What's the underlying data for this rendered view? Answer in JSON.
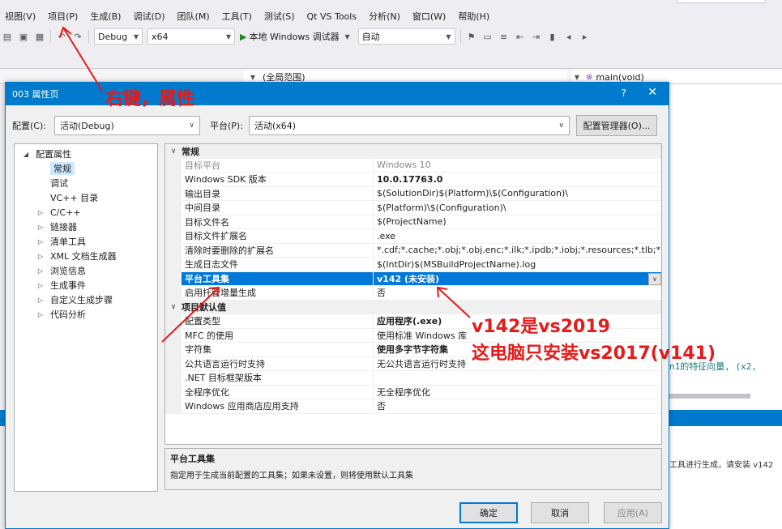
{
  "menu": [
    "视图(V)",
    "项目(P)",
    "生成(B)",
    "调试(D)",
    "团队(M)",
    "工具(T)",
    "测试(S)",
    "Qt VS Tools",
    "分析(N)",
    "窗口(W)",
    "帮助(H)"
  ],
  "toolbar": {
    "config": "Debug",
    "platform": "x64",
    "debugger": "本地 Windows 调试器",
    "mode": "自动"
  },
  "navbar": {
    "scope": "(全局范围)",
    "function": "main(void)"
  },
  "dialog": {
    "title": "003 属性页",
    "help": "?",
    "close": "✕",
    "config_label": "配置(C):",
    "config_value": "活动(Debug)",
    "platform_label": "平台(P):",
    "platform_value": "活动(x64)",
    "config_manager": "配置管理器(O)...",
    "tree": [
      {
        "label": "配置属性",
        "expander": "◢",
        "indent": 0
      },
      {
        "label": "常规",
        "expander": "",
        "indent": 1,
        "selected": true
      },
      {
        "label": "调试",
        "expander": "",
        "indent": 1
      },
      {
        "label": "VC++ 目录",
        "expander": "",
        "indent": 1
      },
      {
        "label": "C/C++",
        "expander": "▷",
        "indent": 1
      },
      {
        "label": "链接器",
        "expander": "▷",
        "indent": 1
      },
      {
        "label": "清单工具",
        "expander": "▷",
        "indent": 1
      },
      {
        "label": "XML 文档生成器",
        "expander": "▷",
        "indent": 1
      },
      {
        "label": "浏览信息",
        "expander": "▷",
        "indent": 1
      },
      {
        "label": "生成事件",
        "expander": "▷",
        "indent": 1
      },
      {
        "label": "自定义生成步骤",
        "expander": "▷",
        "indent": 1
      },
      {
        "label": "代码分析",
        "expander": "▷",
        "indent": 1
      }
    ],
    "grid": [
      {
        "type": "cat",
        "name": "常规"
      },
      {
        "name": "目标平台",
        "value": "Windows 10",
        "disabled": true
      },
      {
        "name": "Windows SDK 版本",
        "value": "10.0.17763.0",
        "bold": true
      },
      {
        "name": "输出目录",
        "value": "$(SolutionDir)$(Platform)\\$(Configuration)\\"
      },
      {
        "name": "中间目录",
        "value": "$(Platform)\\$(Configuration)\\"
      },
      {
        "name": "目标文件名",
        "value": "$(ProjectName)"
      },
      {
        "name": "目标文件扩展名",
        "value": ".exe"
      },
      {
        "name": "清除时要删除的扩展名",
        "value": "*.cdf;*.cache;*.obj;*.obj.enc;*.ilk;*.ipdb;*.iobj;*.resources;*.tlb;*.tli;*.t"
      },
      {
        "name": "生成日志文件",
        "value": "$(IntDir)$(MSBuildProjectName).log"
      },
      {
        "name": "平台工具集",
        "value": "v142 (未安装)",
        "selected": true
      },
      {
        "name": "启用托管增量生成",
        "value": "否"
      },
      {
        "type": "cat",
        "name": "项目默认值"
      },
      {
        "name": "配置类型",
        "value": "应用程序(.exe)",
        "bold": true
      },
      {
        "name": "MFC 的使用",
        "value": "使用标准 Windows 库"
      },
      {
        "name": "字符集",
        "value": "使用多字节字符集",
        "bold": true
      },
      {
        "name": "公共语言运行时支持",
        "value": "无公共语言运行时支持"
      },
      {
        "name": ".NET 目标框架版本",
        "value": ""
      },
      {
        "name": "全程序优化",
        "value": "无全程序优化"
      },
      {
        "name": "Windows 应用商店应用支持",
        "value": "否"
      }
    ],
    "desc_title": "平台工具集",
    "desc_text": "指定用于生成当前配置的工具集；如果未设置，则将使用默认工具集",
    "ok": "确定",
    "cancel": "取消",
    "apply": "应用(A)"
  },
  "background": {
    "editor_hint": "n1的特征向量, (x2,",
    "output_text": "工具进行生成，请安装 v142"
  },
  "annotations": {
    "right_click": "右键，属性",
    "v142": "v142是vs2019",
    "vs2017": "这电脑只安装vs2017(v141)",
    "color": "#e51a1a"
  }
}
